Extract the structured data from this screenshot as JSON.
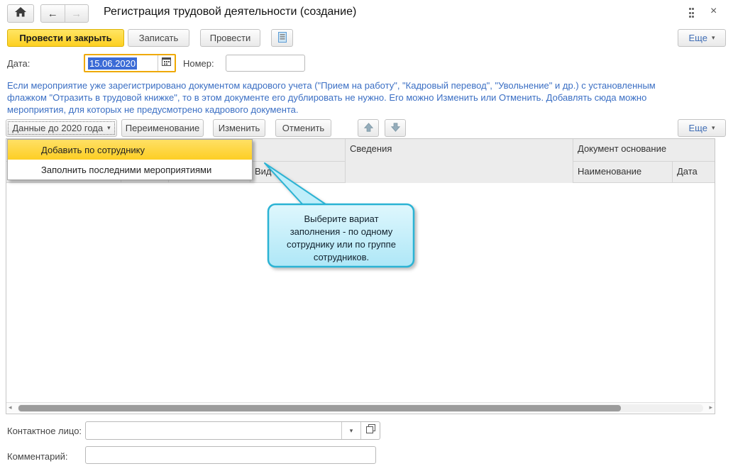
{
  "header": {
    "title": "Регистрация трудовой деятельности (создание)"
  },
  "toolbar": {
    "post_and_close": "Провести и закрыть",
    "save": "Записать",
    "post": "Провести",
    "more": "Еще"
  },
  "doc": {
    "date_label": "Дата:",
    "date_value": "15.06.2020",
    "number_label": "Номер:",
    "number_value": ""
  },
  "hint": {
    "lines": [
      "Если мероприятие уже зарегистрировано документом кадрового учета (\"Прием на работу\", \"Кадровый перевод\", \"Увольнение\" и др.) с установленным",
      "флажком \"Отразить в трудовой книжке\", то в этом документе его дублировать не нужно. Его можно Изменить или Отменить. Добавлять сюда можно",
      "мероприятия, для которых не предусмотрено кадрового документа."
    ]
  },
  "commands": {
    "data_2020": "Данные до 2020 года",
    "rename": "Переименование",
    "edit": "Изменить",
    "cancel": "Отменить",
    "more": "Еще"
  },
  "menu": {
    "items": [
      "Добавить по сотруднику",
      "Заполнить последними мероприятиями"
    ]
  },
  "table": {
    "col_vid": "Вид",
    "col_info": "Сведения",
    "col_doc": "Документ основание",
    "col_name": "Наименование",
    "col_date": "Дата"
  },
  "callout": {
    "lines": [
      "Выберите вариат",
      "заполнения - по одному",
      "сотруднику или по группе",
      "сотрудников."
    ]
  },
  "footer": {
    "contact_label": "Контактное лицо:",
    "contact_value": "",
    "comment_label": "Комментарий:",
    "comment_value": ""
  },
  "icons": {
    "back": "←",
    "forward": "→",
    "close": "×",
    "caret": "▾",
    "scroll_left": "◂",
    "scroll_right": "▸"
  },
  "colors": {
    "accent_yellow": "#fdd022",
    "hint_blue": "#3b6fc4",
    "selection_blue": "#3b6bd6",
    "callout_border": "#2bb3d4",
    "callout_fill": "#c9f0fb"
  }
}
